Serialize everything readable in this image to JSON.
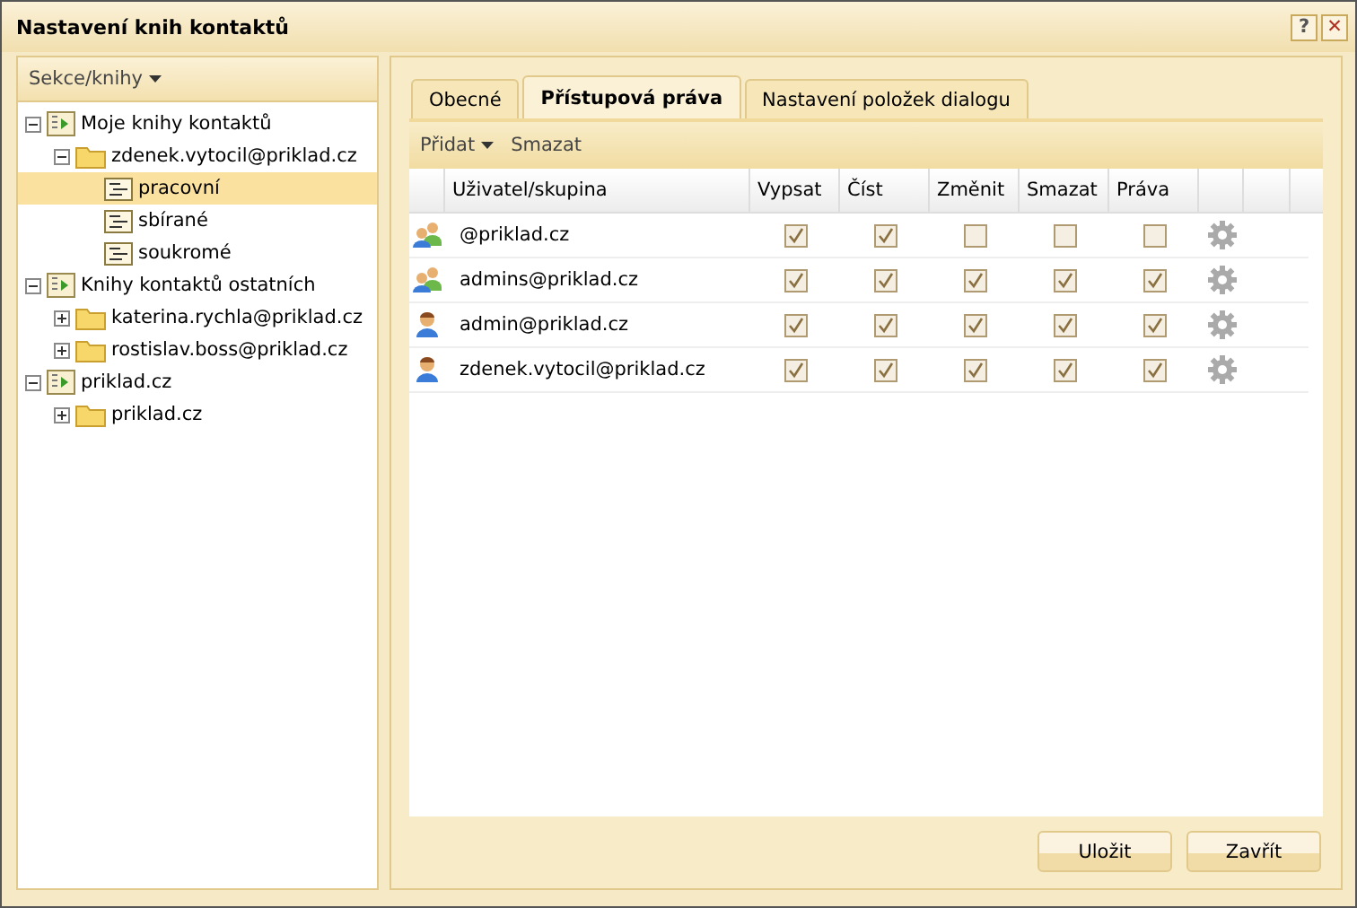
{
  "window": {
    "title": "Nastavení knih kontaktů",
    "buttons": [
      {
        "kind": "help",
        "label": "?"
      },
      {
        "kind": "close",
        "label": "✕"
      }
    ]
  },
  "sidebar": {
    "header": "Sekce/knihy",
    "tree": [
      {
        "label": "Moje knihy kontaktů",
        "kind": "book",
        "expanded": true,
        "selected": false,
        "children": [
          {
            "label": "zdenek.vytocil@priklad.cz",
            "kind": "folder",
            "expanded": true,
            "selected": false,
            "children": [
              {
                "label": "pracovní",
                "kind": "list",
                "selected": true
              },
              {
                "label": "sbírané",
                "kind": "list",
                "selected": false
              },
              {
                "label": "soukromé",
                "kind": "list",
                "selected": false
              }
            ]
          }
        ]
      },
      {
        "label": "Knihy kontaktů ostatních",
        "kind": "book",
        "expanded": true,
        "selected": false,
        "children": [
          {
            "label": "katerina.rychla@priklad.cz",
            "kind": "folder",
            "expanded": false,
            "selected": false
          },
          {
            "label": "rostislav.boss@priklad.cz",
            "kind": "folder",
            "expanded": false,
            "selected": false
          }
        ]
      },
      {
        "label": "priklad.cz",
        "kind": "book",
        "expanded": true,
        "selected": false,
        "children": [
          {
            "label": "priklad.cz",
            "kind": "folder",
            "expanded": false,
            "selected": false
          }
        ]
      }
    ]
  },
  "tabs": [
    {
      "label": "Obecné",
      "selected": false
    },
    {
      "label": "Přístupová práva",
      "selected": true
    },
    {
      "label": "Nastavení položek dialogu",
      "selected": false
    }
  ],
  "toolbar": {
    "add": "Přidat",
    "delete": "Smazat"
  },
  "table": {
    "columns": [
      "Uživatel/skupina",
      "Vypsat",
      "Číst",
      "Změnit",
      "Smazat",
      "Práva"
    ],
    "rows": [
      {
        "kind": "group",
        "name": "@priklad.cz",
        "rights": [
          true,
          true,
          false,
          false,
          false
        ]
      },
      {
        "kind": "group",
        "name": "admins@priklad.cz",
        "rights": [
          true,
          true,
          true,
          true,
          true
        ]
      },
      {
        "kind": "user",
        "name": "admin@priklad.cz",
        "rights": [
          true,
          true,
          true,
          true,
          true
        ]
      },
      {
        "kind": "user",
        "name": "zdenek.vytocil@priklad.cz",
        "rights": [
          true,
          true,
          true,
          true,
          true
        ]
      }
    ]
  },
  "footer": {
    "buttons": [
      "Uložit",
      "Zavřít"
    ]
  }
}
